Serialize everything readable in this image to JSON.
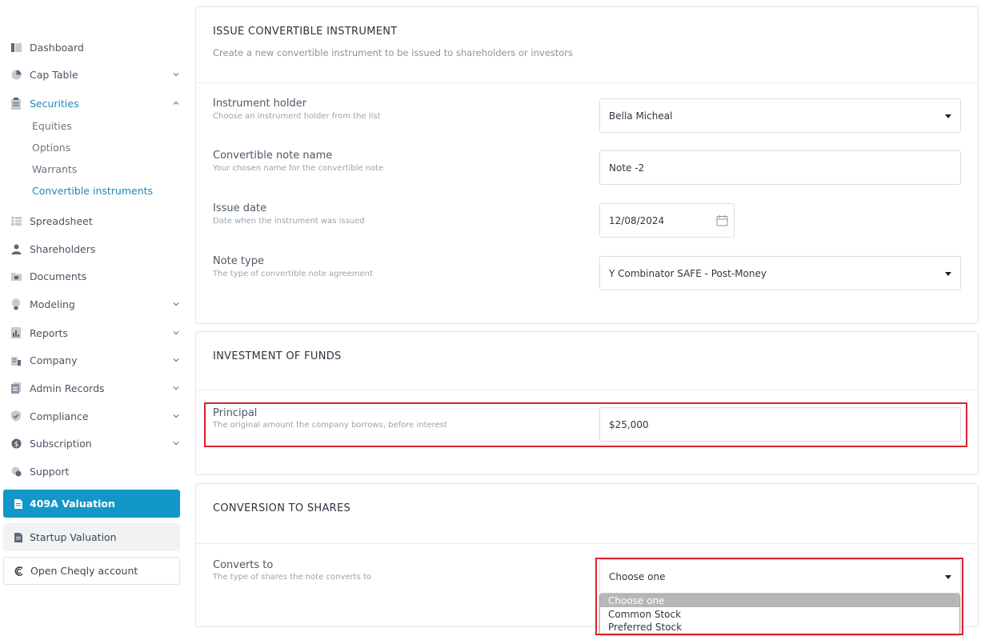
{
  "sidebar": {
    "items": [
      {
        "label": "Dashboard",
        "icon": "dashboard-icon"
      },
      {
        "label": "Cap Table",
        "icon": "pie-chart-icon"
      },
      {
        "label": "Securities",
        "icon": "clipboard-icon"
      },
      {
        "label": "Spreadsheet",
        "icon": "spreadsheet-icon"
      },
      {
        "label": "Shareholders",
        "icon": "person-icon"
      },
      {
        "label": "Documents",
        "icon": "folder-icon"
      },
      {
        "label": "Modeling",
        "icon": "lightbulb-icon"
      },
      {
        "label": "Reports",
        "icon": "reports-icon"
      },
      {
        "label": "Company",
        "icon": "building-icon"
      },
      {
        "label": "Admin Records",
        "icon": "admin-records-icon"
      },
      {
        "label": "Compliance",
        "icon": "shield-check-icon"
      },
      {
        "label": "Subscription",
        "icon": "dollar-coin-icon"
      },
      {
        "label": "Support",
        "icon": "support-icon"
      }
    ],
    "securities_sub": [
      "Equities",
      "Options",
      "Warrants",
      "Convertible instruments"
    ],
    "buttons": {
      "valuation_409a": "409A Valuation",
      "startup_valuation": "Startup Valuation",
      "open_cheqly": "Open Cheqly account"
    }
  },
  "issue": {
    "title": "ISSUE CONVERTIBLE INSTRUMENT",
    "subtitle": "Create a new convertible instrument to be issued to shareholders or investors",
    "holder": {
      "label": "Instrument holder",
      "help": "Choose an instrument holder from the list",
      "value": "Bella Micheal"
    },
    "note_name": {
      "label": "Convertible note name",
      "help": "Your chosen name for the convertible note",
      "value": "Note -2"
    },
    "issue_date": {
      "label": "Issue date",
      "help": "Date when the instrument was issued",
      "value": "12/08/2024"
    },
    "note_type": {
      "label": "Note type",
      "help": "The type of convertible note agreement",
      "value": "Y Combinator SAFE - Post-Money"
    }
  },
  "investment": {
    "title": "INVESTMENT OF FUNDS",
    "principal": {
      "label": "Principal",
      "help": "The original amount the company borrows, before interest",
      "value": "$25,000"
    }
  },
  "conversion": {
    "title": "CONVERSION TO SHARES",
    "converts_to": {
      "label": "Converts to",
      "help": "The type of shares the note converts to",
      "value": "Choose one",
      "options": [
        "Choose one",
        "Common Stock",
        "Preferred Stock"
      ]
    }
  },
  "colors": {
    "accent": "#1396c8",
    "active_link": "#1f87b5",
    "highlight": "#d8232a"
  }
}
